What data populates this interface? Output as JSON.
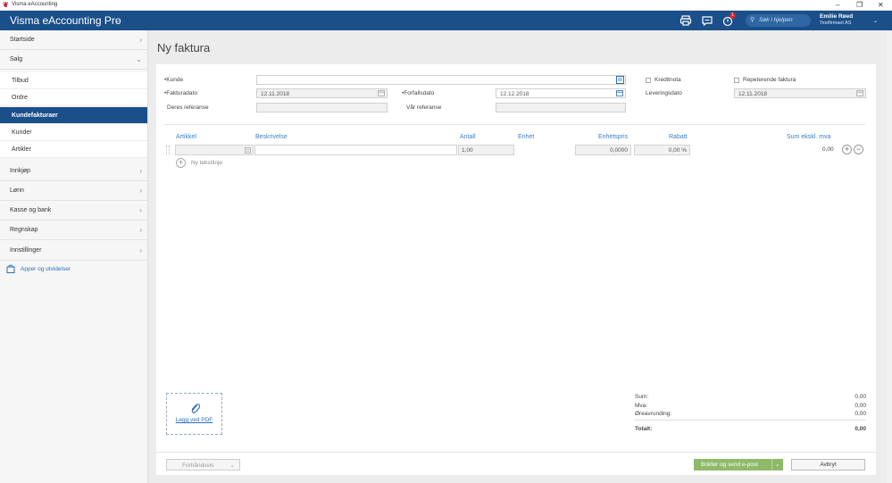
{
  "window": {
    "title": "Visma eAccounting",
    "minimize": "–",
    "maximize": "❐",
    "close": "✕"
  },
  "header": {
    "brand": "Visma eAccounting Pro",
    "search_placeholder": "Søk i hjelpen",
    "notification_count": "1",
    "user_name": "Emilie Røed",
    "company": "Testfirmaet AS",
    "accent": "#1a4f8a"
  },
  "sidebar": {
    "items": [
      {
        "label": "Startside"
      },
      {
        "label": "Salg"
      },
      {
        "label": "Innkjøp"
      },
      {
        "label": "Lønn"
      },
      {
        "label": "Kasse og bank"
      },
      {
        "label": "Regnskap"
      },
      {
        "label": "Innstillinger"
      }
    ],
    "sub_items": [
      {
        "label": "Tilbud"
      },
      {
        "label": "Ordre"
      },
      {
        "label": "Kundefakturaer"
      },
      {
        "label": "Kunder"
      },
      {
        "label": "Artikler"
      }
    ],
    "apps_label": "Apper og utvidelser"
  },
  "page": {
    "title": "Ny faktura",
    "fields": {
      "kunde_label": "•Kunde",
      "kunde_value": "",
      "fakturadato_label": "•Fakturadato",
      "fakturadato_value": "12.11.2018",
      "forfallsdato_label": "•Forfallsdato",
      "forfallsdato_value": "12.12.2018",
      "deres_ref_label": "Deres referanse",
      "deres_ref_value": "",
      "var_ref_label": "Vår referanse",
      "var_ref_value": "",
      "kreditnota_label": "Kreditnota",
      "repeterende_label": "Repeterende faktura",
      "leveringsdato_label": "Leveringsdato",
      "leveringsdato_value": "12.11.2018"
    },
    "table": {
      "headers": {
        "artikkel": "Artikkel",
        "beskrivelse": "Beskrivelse",
        "antall": "Antall",
        "enhet": "Enhet",
        "enhetspris": "Enhetspris",
        "rabatt": "Rabatt",
        "sum": "Sum ekskl. mva"
      },
      "row": {
        "artikkel": "",
        "beskrivelse": "",
        "antall": "1,00",
        "enhetspris": "0,0000",
        "rabatt": "0,00 %",
        "sum": "0,00"
      },
      "add_row_icon": "+",
      "remove_row_icon": "−",
      "new_text_line": "Ny tekstlinje"
    },
    "attach_pdf": "Legg ved PDF",
    "totals": {
      "sum_label": "Sum:",
      "sum_value": "0,00",
      "mva_label": "Mva:",
      "mva_value": "0,00",
      "rounding_label": "Øreavrunding:",
      "rounding_value": "0,00",
      "total_label": "Totalt:",
      "total_value": "0,00"
    },
    "footer": {
      "preview_label": "Forhåndsvis",
      "book_send_label": "Bokfør og send e-post",
      "cancel_label": "Avbryt"
    }
  }
}
